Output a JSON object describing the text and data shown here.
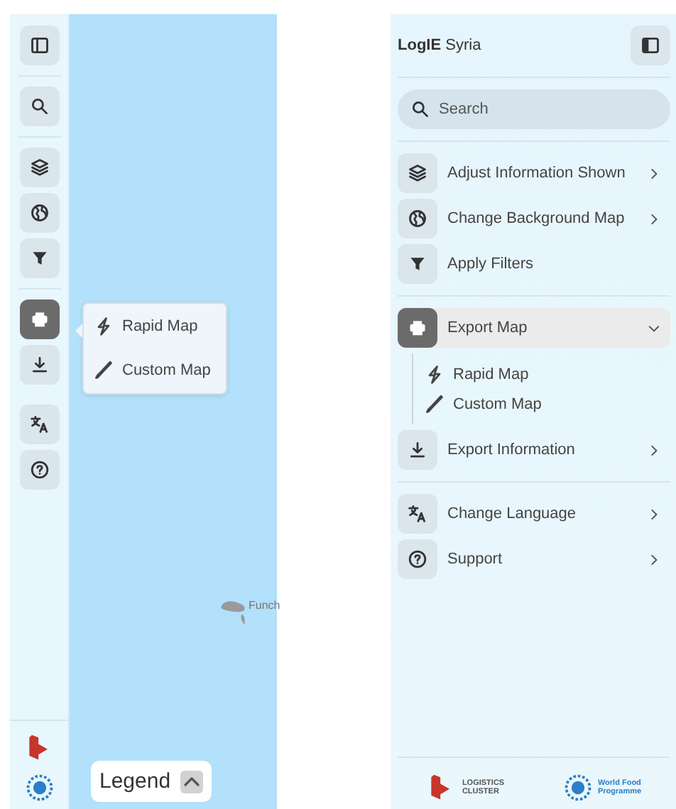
{
  "collapsed_sidebar": {
    "groups": [
      [
        {
          "kind": "panel",
          "selected": false
        }
      ],
      [
        {
          "kind": "search",
          "selected": false
        }
      ],
      [
        {
          "kind": "layers",
          "selected": false
        },
        {
          "kind": "globe",
          "selected": false
        },
        {
          "kind": "filter",
          "selected": false
        }
      ],
      [
        {
          "kind": "print",
          "selected": true
        },
        {
          "kind": "download",
          "selected": false
        }
      ],
      [
        {
          "kind": "translate",
          "selected": false
        },
        {
          "kind": "help",
          "selected": false
        }
      ]
    ]
  },
  "popup": {
    "items": [
      {
        "kind": "rapid",
        "label": "Rapid Map"
      },
      {
        "kind": "custom",
        "label": "Custom Map"
      }
    ]
  },
  "map": {
    "labels": [
      "Funch"
    ]
  },
  "legend": {
    "label": "Legend",
    "expanded": false
  },
  "panel": {
    "brand": "LogIE",
    "subtitle": "Syria",
    "search": {
      "placeholder": "Search"
    },
    "groups": [
      [
        {
          "kind": "layers",
          "label": "Adjust Information Shown",
          "selected": false,
          "expanded": false
        },
        {
          "kind": "globe",
          "label": "Change Background Map",
          "selected": false,
          "expanded": false
        },
        {
          "kind": "filter",
          "label": "Apply Filters",
          "selected": false
        }
      ],
      [
        {
          "kind": "print",
          "label": "Export Map",
          "selected": true,
          "expanded": true,
          "children": [
            {
              "kind": "rapid",
              "label": "Rapid Map"
            },
            {
              "kind": "custom",
              "label": "Custom Map"
            }
          ]
        },
        {
          "kind": "download",
          "label": "Export Information",
          "selected": false,
          "expanded": false
        }
      ],
      [
        {
          "kind": "translate",
          "label": "Change Language",
          "selected": false,
          "expanded": false
        },
        {
          "kind": "help",
          "label": "Support",
          "selected": false,
          "expanded": false
        }
      ]
    ],
    "footer": {
      "logos": [
        {
          "kind": "cluster",
          "lines": [
            "LOGISTICS",
            "CLUSTER"
          ]
        },
        {
          "kind": "wfp",
          "lines": [
            "World Food",
            "Programme"
          ]
        }
      ]
    }
  }
}
